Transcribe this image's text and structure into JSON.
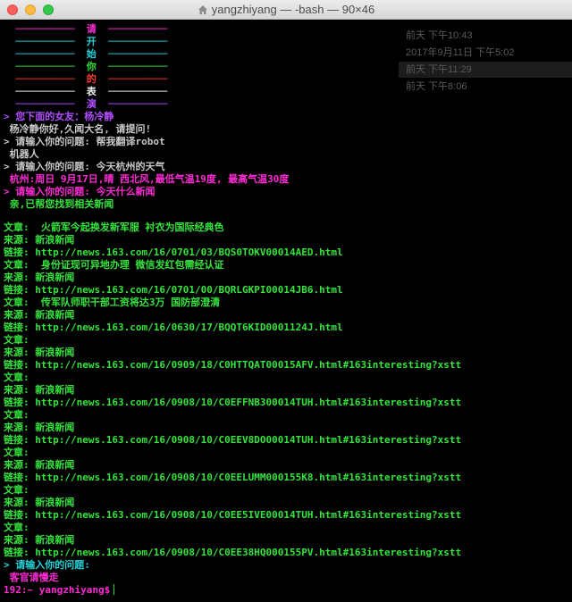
{
  "window": {
    "title": "yangzhiyang — -bash — 90×46"
  },
  "colors": {
    "magenta": "#ff2bd5",
    "cyan": "#21d0d8",
    "green": "#35e33d",
    "red": "#ff3b2f",
    "white": "#f0f0f0",
    "purple": "#b14cff",
    "gray": "#c8c8c8",
    "notice_text": "#5a5a5a"
  },
  "banner": [
    {
      "char": "请",
      "color": "#ff2bd5"
    },
    {
      "char": "开",
      "color": "#21d0d8"
    },
    {
      "char": "始",
      "color": "#21d0d8"
    },
    {
      "char": "你",
      "color": "#35e33d"
    },
    {
      "char": "的",
      "color": "#ff3b2f"
    },
    {
      "char": "表",
      "color": "#f0f0f0"
    },
    {
      "char": "演",
      "color": "#b14cff"
    }
  ],
  "notifications": [
    "前天 下午10:43",
    "2017年9月11日 下午5:02",
    "前天 下午11:29",
    "前天 下午8:06"
  ],
  "chat": [
    {
      "text": "> 您下面的女友：杨冷静",
      "color": "#b14cff"
    },
    {
      "text": " 杨冷静你好,久闻大名, 请提问!",
      "color": "#c8c8c8"
    },
    {
      "text": "> 请输入你的问题: 帮我翻译robot",
      "color": "#c8c8c8"
    },
    {
      "text": " 机器人",
      "color": "#c8c8c8"
    },
    {
      "text": "> 请输入你的问题: 今天杭州的天气",
      "color": "#c8c8c8"
    },
    {
      "text": " 杭州:周日 9月17日,晴 西北风,最低气温19度, 最高气温30度",
      "color": "#ff2bd5"
    },
    {
      "text": "> 请输入你的问题: 今天什么新闻",
      "color": "#ff2bd5"
    },
    {
      "text": " 亲,已帮您找到相关新闻",
      "color": "#35e33d"
    }
  ],
  "news": [
    {
      "article": "文章:  火箭军今起换发新军服 衬衣为国际经典色",
      "source": "来源: 新浪新闻",
      "link": "链接: http://news.163.com/16/0701/03/BQS0TOKV00014AED.html"
    },
    {
      "article": "文章:  身份证现可异地办理 微信发红包需经认证",
      "source": "来源: 新浪新闻",
      "link": "链接: http://news.163.com/16/0701/00/BQRLGKPI00014JB6.html"
    },
    {
      "article": "文章:  传军队师职干部工资将达3万 国防部澄清",
      "source": "来源: 新浪新闻",
      "link": "链接: http://news.163.com/16/0630/17/BQQT6KID0001124J.html"
    },
    {
      "article": "文章:",
      "source": "来源: 新浪新闻",
      "link": "链接: http://news.163.com/16/0909/18/C0HTTQAT00015AFV.html#163interesting?xstt"
    },
    {
      "article": "文章:",
      "source": "来源: 新浪新闻",
      "link": "链接: http://news.163.com/16/0908/10/C0EFFNB300014TUH.html#163interesting?xstt"
    },
    {
      "article": "文章:",
      "source": "来源: 新浪新闻",
      "link": "链接: http://news.163.com/16/0908/10/C0EEV8DO00014TUH.html#163interesting?xstt"
    },
    {
      "article": "文章:",
      "source": "来源: 新浪新闻",
      "link": "链接: http://news.163.com/16/0908/10/C0EELUMM000155K8.html#163interesting?xstt"
    },
    {
      "article": "文章:",
      "source": "来源: 新浪新闻",
      "link": "链接: http://news.163.com/16/0908/10/C0EE5IVE00014TUH.html#163interesting?xstt"
    },
    {
      "article": "文章:",
      "source": "来源: 新浪新闻",
      "link": "链接: http://news.163.com/16/0908/10/C0EE38HQ000155PV.html#163interesting?xstt"
    }
  ],
  "footer": {
    "prompt_line": "> 请输入你的问题:",
    "farewell": " 客官请慢走",
    "shell_prompt": "192:~ yangzhiyang$"
  }
}
